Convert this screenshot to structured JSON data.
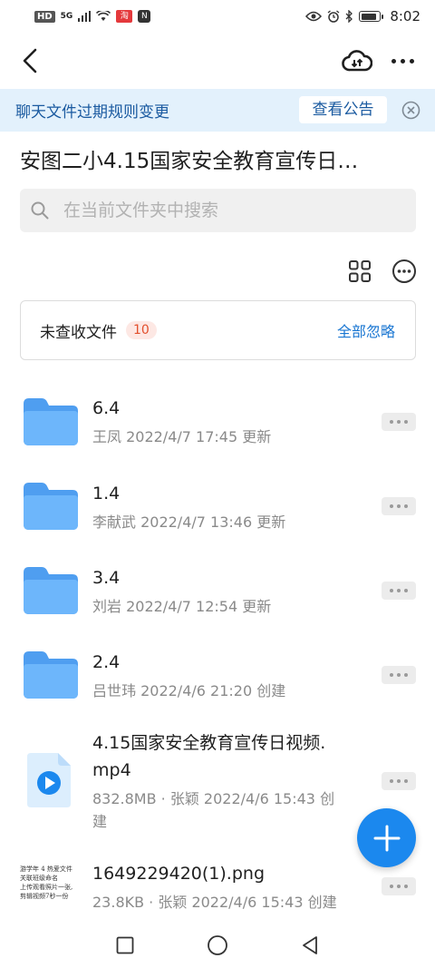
{
  "status_bar": {
    "left": {
      "hd": "HD",
      "net": "5G",
      "app1": "淘",
      "app2": "N"
    },
    "battery_level": 0.85,
    "time": "8:02"
  },
  "nav": {
    "icons": [
      "back-icon",
      "cloud-sync-icon",
      "more-icon"
    ]
  },
  "notice": {
    "text": "聊天文件过期规则变更",
    "button": "查看公告"
  },
  "title": "安图二小4.15国家安全教育宣传日…",
  "search": {
    "placeholder": "在当前文件夹中搜索",
    "value": ""
  },
  "unread": {
    "label": "未查收文件",
    "count": "10",
    "action": "全部忽略"
  },
  "files": [
    {
      "name": "6.4",
      "meta": "王凤 2022/4/7 17:45 更新",
      "type": "folder"
    },
    {
      "name": "1.4",
      "meta": "李献武 2022/4/7 13:46 更新",
      "type": "folder"
    },
    {
      "name": "3.4",
      "meta": "刘岩 2022/4/7 12:54 更新",
      "type": "folder"
    },
    {
      "name": "2.4",
      "meta": "吕世玮 2022/4/6 21:20 创建",
      "type": "folder"
    },
    {
      "name_line1": "4.15国家安全教育宣传日视频.",
      "name_line2": "mp4",
      "meta_line1": "832.8MB · 张颖 2022/4/6 15:43 创",
      "meta_line2": "建",
      "type": "video"
    },
    {
      "name": "1649229420(1).png",
      "meta": "23.8KB · 张颖 2022/4/6 15:43 创建",
      "type": "image",
      "thumb_lines": [
        "游学年 4 热爱文件",
        "关联班级命名",
        "",
        "上传观看照片一张,",
        "剪辑视频7秒一份"
      ]
    }
  ],
  "colors": {
    "accent": "#1b88ee",
    "folder": "#5aa8f5",
    "notice_bg": "#e3f1fc"
  }
}
